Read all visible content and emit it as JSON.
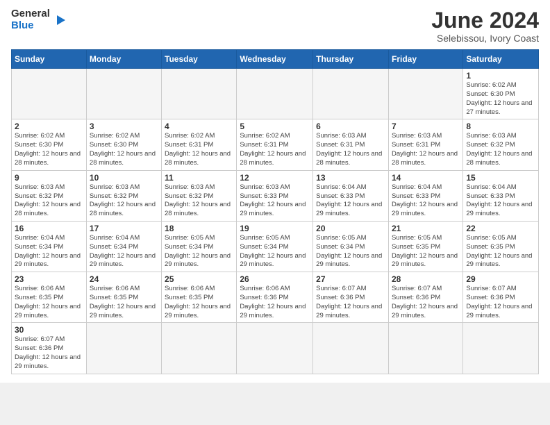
{
  "header": {
    "logo_general": "General",
    "logo_blue": "Blue",
    "title": "June 2024",
    "location": "Selebissou, Ivory Coast"
  },
  "weekdays": [
    "Sunday",
    "Monday",
    "Tuesday",
    "Wednesday",
    "Thursday",
    "Friday",
    "Saturday"
  ],
  "weeks": [
    [
      {
        "day": "",
        "empty": true
      },
      {
        "day": "",
        "empty": true
      },
      {
        "day": "",
        "empty": true
      },
      {
        "day": "",
        "empty": true
      },
      {
        "day": "",
        "empty": true
      },
      {
        "day": "",
        "empty": true
      },
      {
        "day": "1",
        "sunrise": "6:02 AM",
        "sunset": "6:30 PM",
        "daylight": "12 hours and 27 minutes."
      }
    ],
    [
      {
        "day": "2",
        "sunrise": "6:02 AM",
        "sunset": "6:30 PM",
        "daylight": "12 hours and 28 minutes."
      },
      {
        "day": "3",
        "sunrise": "6:02 AM",
        "sunset": "6:30 PM",
        "daylight": "12 hours and 28 minutes."
      },
      {
        "day": "4",
        "sunrise": "6:02 AM",
        "sunset": "6:31 PM",
        "daylight": "12 hours and 28 minutes."
      },
      {
        "day": "5",
        "sunrise": "6:02 AM",
        "sunset": "6:31 PM",
        "daylight": "12 hours and 28 minutes."
      },
      {
        "day": "6",
        "sunrise": "6:03 AM",
        "sunset": "6:31 PM",
        "daylight": "12 hours and 28 minutes."
      },
      {
        "day": "7",
        "sunrise": "6:03 AM",
        "sunset": "6:31 PM",
        "daylight": "12 hours and 28 minutes."
      },
      {
        "day": "8",
        "sunrise": "6:03 AM",
        "sunset": "6:32 PM",
        "daylight": "12 hours and 28 minutes."
      }
    ],
    [
      {
        "day": "9",
        "sunrise": "6:03 AM",
        "sunset": "6:32 PM",
        "daylight": "12 hours and 28 minutes."
      },
      {
        "day": "10",
        "sunrise": "6:03 AM",
        "sunset": "6:32 PM",
        "daylight": "12 hours and 28 minutes."
      },
      {
        "day": "11",
        "sunrise": "6:03 AM",
        "sunset": "6:32 PM",
        "daylight": "12 hours and 28 minutes."
      },
      {
        "day": "12",
        "sunrise": "6:03 AM",
        "sunset": "6:33 PM",
        "daylight": "12 hours and 29 minutes."
      },
      {
        "day": "13",
        "sunrise": "6:04 AM",
        "sunset": "6:33 PM",
        "daylight": "12 hours and 29 minutes."
      },
      {
        "day": "14",
        "sunrise": "6:04 AM",
        "sunset": "6:33 PM",
        "daylight": "12 hours and 29 minutes."
      },
      {
        "day": "15",
        "sunrise": "6:04 AM",
        "sunset": "6:33 PM",
        "daylight": "12 hours and 29 minutes."
      }
    ],
    [
      {
        "day": "16",
        "sunrise": "6:04 AM",
        "sunset": "6:34 PM",
        "daylight": "12 hours and 29 minutes."
      },
      {
        "day": "17",
        "sunrise": "6:04 AM",
        "sunset": "6:34 PM",
        "daylight": "12 hours and 29 minutes."
      },
      {
        "day": "18",
        "sunrise": "6:05 AM",
        "sunset": "6:34 PM",
        "daylight": "12 hours and 29 minutes."
      },
      {
        "day": "19",
        "sunrise": "6:05 AM",
        "sunset": "6:34 PM",
        "daylight": "12 hours and 29 minutes."
      },
      {
        "day": "20",
        "sunrise": "6:05 AM",
        "sunset": "6:34 PM",
        "daylight": "12 hours and 29 minutes."
      },
      {
        "day": "21",
        "sunrise": "6:05 AM",
        "sunset": "6:35 PM",
        "daylight": "12 hours and 29 minutes."
      },
      {
        "day": "22",
        "sunrise": "6:05 AM",
        "sunset": "6:35 PM",
        "daylight": "12 hours and 29 minutes."
      }
    ],
    [
      {
        "day": "23",
        "sunrise": "6:06 AM",
        "sunset": "6:35 PM",
        "daylight": "12 hours and 29 minutes."
      },
      {
        "day": "24",
        "sunrise": "6:06 AM",
        "sunset": "6:35 PM",
        "daylight": "12 hours and 29 minutes."
      },
      {
        "day": "25",
        "sunrise": "6:06 AM",
        "sunset": "6:35 PM",
        "daylight": "12 hours and 29 minutes."
      },
      {
        "day": "26",
        "sunrise": "6:06 AM",
        "sunset": "6:36 PM",
        "daylight": "12 hours and 29 minutes."
      },
      {
        "day": "27",
        "sunrise": "6:07 AM",
        "sunset": "6:36 PM",
        "daylight": "12 hours and 29 minutes."
      },
      {
        "day": "28",
        "sunrise": "6:07 AM",
        "sunset": "6:36 PM",
        "daylight": "12 hours and 29 minutes."
      },
      {
        "day": "29",
        "sunrise": "6:07 AM",
        "sunset": "6:36 PM",
        "daylight": "12 hours and 29 minutes."
      }
    ],
    [
      {
        "day": "30",
        "sunrise": "6:07 AM",
        "sunset": "6:36 PM",
        "daylight": "12 hours and 29 minutes."
      },
      {
        "day": "",
        "empty": true
      },
      {
        "day": "",
        "empty": true
      },
      {
        "day": "",
        "empty": true
      },
      {
        "day": "",
        "empty": true
      },
      {
        "day": "",
        "empty": true
      },
      {
        "day": "",
        "empty": true
      }
    ]
  ]
}
